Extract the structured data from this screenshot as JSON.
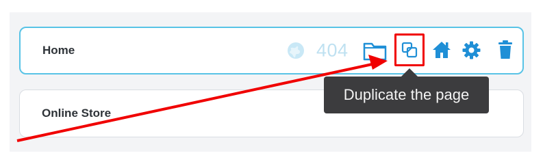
{
  "pages": [
    {
      "label": "Home",
      "code": "404"
    },
    {
      "label": "Online Store"
    }
  ],
  "tooltip": {
    "text": "Duplicate the page"
  },
  "colors": {
    "accent": "#58c3e6",
    "icon_blue": "#1f8fd6",
    "highlight_red": "#f00000",
    "tooltip_bg": "#3c3c3e"
  },
  "icons": [
    "globe-icon",
    "folder-icon",
    "duplicate-icon",
    "home-icon",
    "gear-icon",
    "trash-icon"
  ]
}
